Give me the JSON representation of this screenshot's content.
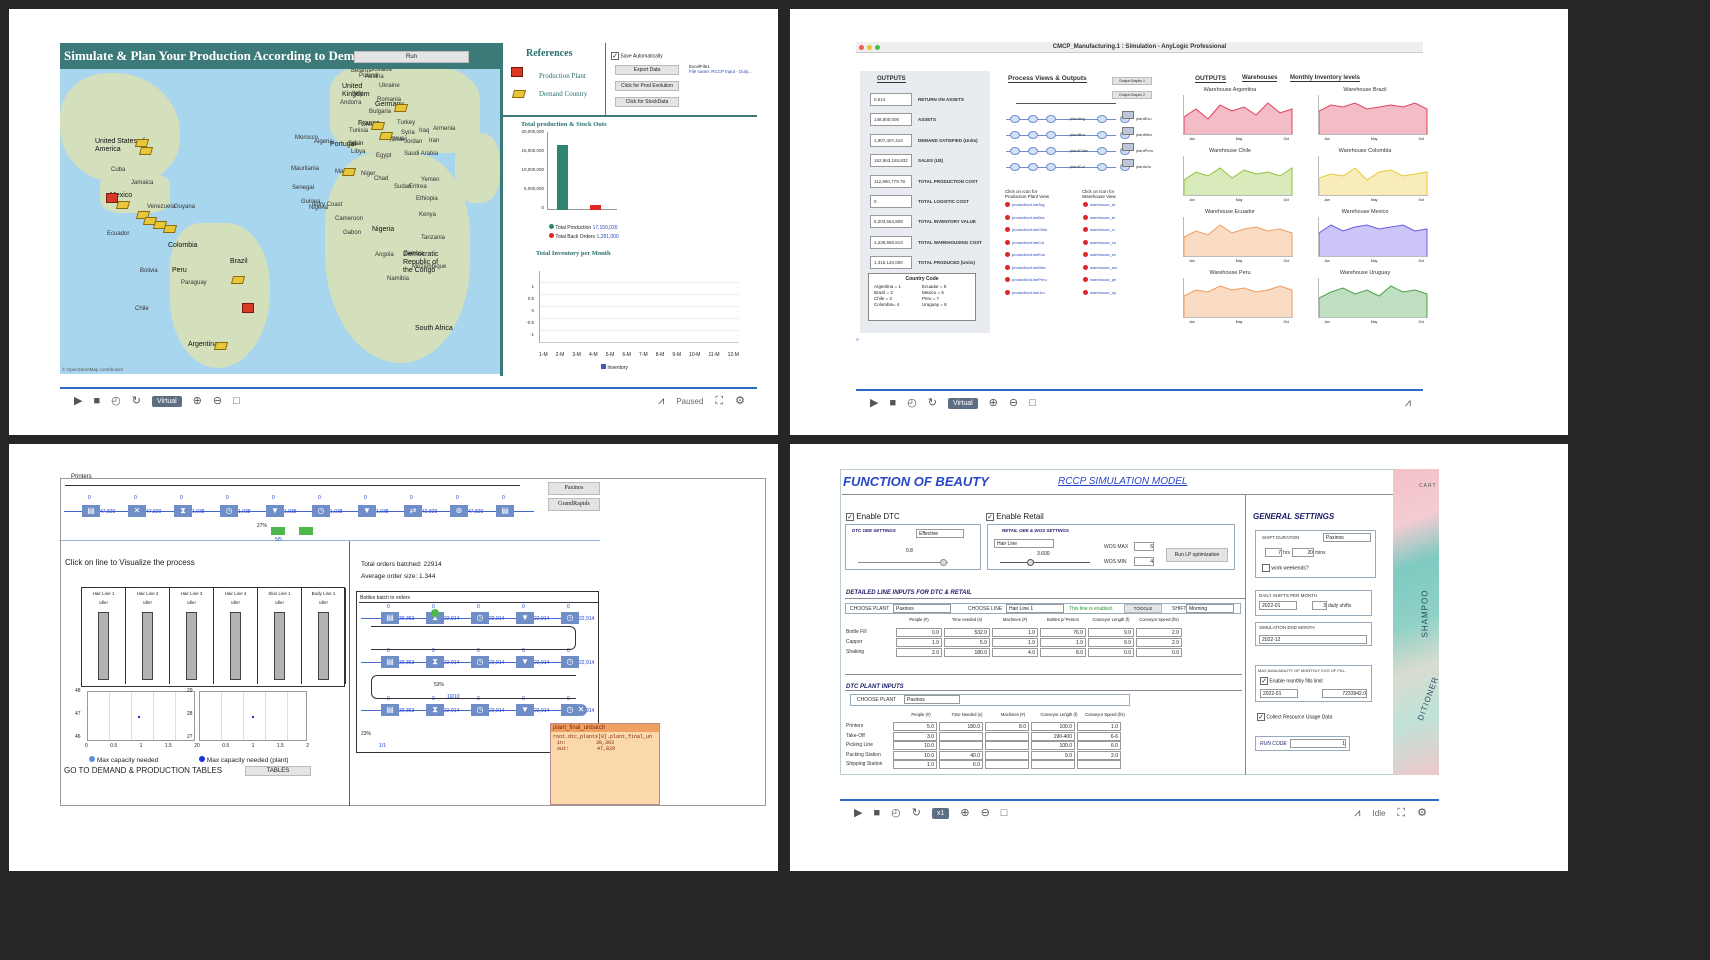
{
  "p1": {
    "title": "Simulate & Plan Your Production According to Demand",
    "run": "Run",
    "references": "References",
    "ref_plant": "Production Plant",
    "ref_country": "Demand Country",
    "save_auto": "Save Automatically",
    "btn_export": "Export Data",
    "btn_prod_evo": "Click for Prod Evolution",
    "btn_stock": "Click for StockData",
    "excel": "ExcelFile1",
    "excel_sub": "File name: RCCP Input - Duly...",
    "chart1_title": "Total production & Stock Outs",
    "chart1_yticks": [
      "20,000,000",
      "15,000,000",
      "10,000,000",
      "5,000,000",
      "0"
    ],
    "legend_prod": "Total Production",
    "legend_prod_val": "17,150,020",
    "legend_back": "Total Back Orders",
    "legend_back_val": "1,281,000",
    "chart2_title": "Total Inventory per Month",
    "chart2_yticks": [
      "1",
      "0.5",
      "0",
      "-0.5",
      "-1"
    ],
    "chart2_xticks": [
      "1-M",
      "2-M",
      "3-M",
      "4-M",
      "5-M",
      "6-M",
      "7-M",
      "8-M",
      "9-M",
      "10-M",
      "11-M",
      "12-M"
    ],
    "legend_inv": "Inventory",
    "osm": "© OpenStreetMap contributors",
    "status": "Paused",
    "virtual": "Virtual",
    "map_labels": [
      "Estonia",
      "Lithuania",
      "Belarus",
      "Poland",
      "Ukraine",
      "Romania",
      "Bulgaria",
      "Greece",
      "Turkey",
      "Cyprus",
      "Syria",
      "Iraq",
      "Iran",
      "Israel",
      "Jordan",
      "Egypt",
      "Saudi Arabia",
      "Libya",
      "Tunisia",
      "Algeria",
      "Morocco",
      "Mauritania",
      "Mali",
      "Niger",
      "Chad",
      "Sudan",
      "Eritrea",
      "Yemen",
      "Ethiopia",
      "Kenya",
      "Tanzania",
      "Angola",
      "Zambia",
      "Namibia",
      "Mozambique",
      "Senegal",
      "Guinea",
      "Ivory Coast",
      "Nigeria",
      "Cameroon",
      "Gabon",
      "Cuba",
      "Jamaica",
      "Venezuela",
      "Guyana",
      "Ecuador",
      "Bolivia",
      "Paraguay",
      "Chile",
      "Czechia",
      "Slovakia",
      "Austria",
      "Italy",
      "Andorra",
      "Armenia"
    ],
    "map_big": {
      "us": "United States of America",
      "uk": "United Kingdom",
      "de": "Germany",
      "fr": "France",
      "pt": "Portugal",
      "pe": "Peru",
      "co": "Colombia",
      "br": "Brazil",
      "ar": "Argentina",
      "mx": "Mexico",
      "ng": "Nigeria",
      "cd": "Democratic Republic of the Congo",
      "za": "South Africa",
      "es": "Spain"
    }
  },
  "p2": {
    "window_title": "CMCP_Manufacturing.1 : Simulation - AnyLogic Professional",
    "outputs": "OUTPUTS",
    "rows": [
      {
        "val": "0.514",
        "label": "RETURN ON ASSETS"
      },
      {
        "val": "148,800,000",
        "label": "ASSETS"
      },
      {
        "val": "1,907,407,414",
        "label": "DEMAND SATISFIED (Units)"
      },
      {
        "val": "162,863,165,832",
        "label": "SALES (U$)"
      },
      {
        "val": "112,960,779.78",
        "label": "TOTAL PRODUCTION COST"
      },
      {
        "val": "0",
        "label": "TOTAL LOGISTIC COST"
      },
      {
        "val": "6,203,564,809",
        "label": "TOTAL INVENTORY VALUE"
      },
      {
        "val": "1,239,560,813",
        "label": "TOTAL WAREHOUSING COST"
      },
      {
        "val": "1,316,140,000",
        "label": "TOTAL PRODUCED (Units)"
      }
    ],
    "country_code": "Country Code",
    "codes": [
      "Argentina = 1",
      "Ecuador = 5",
      "Brazil = 2",
      "Mexico = 6",
      "Chile = 3",
      "Peru = 7",
      "Colombia= 4",
      "Uruguay = 8"
    ],
    "process_title": "Process Views & Outputs",
    "out_graph1": "Output Graphs 1",
    "out_graph2": "Output Graphs 2",
    "plants": [
      "plantArg",
      "plantBra",
      "plantChile",
      "plantCol"
    ],
    "plants_right": [
      "plantEcu",
      "plantMex",
      "plantPeru",
      "plantUru"
    ],
    "click_prod": "Click on Icon for Production Plant View",
    "click_wh": "Click on Icon for Warehouse View",
    "prod_lines": [
      "productionLineArg",
      "productionLineBra",
      "productionLineChile",
      "productionLineCol",
      "productionLineEcu",
      "productionLineMex",
      "productionLinePeru",
      "productionLineUru"
    ],
    "wh_items": [
      "warehouse_ar",
      "warehouse_br",
      "warehouse_cl",
      "warehouse_co",
      "warehouse_ec",
      "warehouse_mx",
      "warehouse_pe",
      "warehouse_uy"
    ],
    "outputs2": "OUTPUTS",
    "tab_wh": "Warehouses",
    "tab_inv": "Monthly Inventory levels",
    "warehouses": [
      {
        "name": "Warehouse Argentina",
        "color": "#e0405f"
      },
      {
        "name": "Warehouse Brazil",
        "color": "#e0405f"
      },
      {
        "name": "Warehouse Chile",
        "color": "#8fc43a"
      },
      {
        "name": "Warehouse Colombia",
        "color": "#e8c93a"
      },
      {
        "name": "Warehouse Ecuador",
        "color": "#f29a5a"
      },
      {
        "name": "Warehouse Mexico",
        "color": "#6a5ce8"
      },
      {
        "name": "Warehouse Peru",
        "color": "#f29a5a"
      },
      {
        "name": "Warehouse Uruguay",
        "color": "#4aa04a"
      }
    ],
    "months": [
      "Jan",
      "May",
      "Oct"
    ],
    "virtual": "Virtual"
  },
  "p3": {
    "title": "Printers",
    "btn1": "Paxinos",
    "btn2": "GrandRapids",
    "flow_vals": [
      "47,829",
      "47,829",
      "1,038",
      "1,038",
      "1,038",
      "1,038",
      "1,038",
      "42,829",
      "47,829"
    ],
    "click_line": "Click on line to Visualize the process",
    "lines": [
      "Hair Line 1",
      "Hair Line 2",
      "Hair Line 3",
      "Hair Line 4",
      "Skin Line 1",
      "Body Line 1"
    ],
    "idle": "Idle!",
    "total_batched": "Total orders batched: 22914",
    "avg_size": "Average order size: 1.344",
    "bottles_title": "Bottles batch to orders",
    "batch_vals": [
      "30,363",
      "22,914",
      "22,914",
      "22,914",
      "22,914"
    ],
    "pct1": "27%",
    "pct2": "53%",
    "pct3": "23%",
    "frac1": "5/5",
    "frac2": "10/10",
    "frac3": "1/1",
    "legend1": "Max capacity needed",
    "legend2": "Max capacity needed (plant)",
    "goto": "GO TO DEMAND & PRODUCTION TABLES",
    "tables": "TABLES",
    "chart_l_y": [
      "48",
      "47",
      "46"
    ],
    "chart_r_y": [
      "29",
      "28",
      "27"
    ],
    "chart_x": [
      "0",
      "0.5",
      "1",
      "1.5",
      "2"
    ],
    "tooltip_title": "plant_final_unbatch",
    "tooltip_l1": "root.dtc_plants[0].plant_final_un",
    "tooltip_in": "in:",
    "tooltip_in_val": "30,363",
    "tooltip_out": "out:",
    "tooltip_out_val": "47,829"
  },
  "p4": {
    "brand": "FUNCTION OF BEAUTY",
    "model": "RCCP SIMULATION MODEL",
    "enable_dtc": "Enable DTC",
    "enable_retail": "Enable Retail",
    "dtc_oee": "DTC OEE SETTINGS",
    "dtc_oee_val": "Effective",
    "dtc_slider_val": "0.8",
    "retail_oee": "RETAIL OEE & WOS SETTINGS",
    "retail_line": "Hair Line",
    "retail_slider_val": "3.600",
    "wos_max": "WOS MAX",
    "wos_max_val": "6",
    "wos_min": "WOS MIN",
    "wos_min_val": "4",
    "run_lp": "Run LP optimization",
    "general": "GENERAL SETTINGS",
    "shift_duration": "SHIFT DURATION",
    "shift_plant": "Paxinos",
    "shift_hrs": "7",
    "hrs": "hrs",
    "shift_mins": "20",
    "mins": "mins",
    "work_weekends": "work weekends?",
    "daily_shifts": "DAILY SHIFTS PER MONTH",
    "daily_month": "2022-01",
    "daily_val": "3",
    "daily_unit": "daily shifts",
    "sim_end": "SIMULATION END MONTH",
    "sim_end_val": "2022-12",
    "max_kgs": "MAX AVAILABILITY OF MONTHLY KGS OF FILL",
    "enable_fills": "Enable monthly fills limit",
    "kgs_month": "2022-01",
    "kgs_val": "7233942.0",
    "collect": "Collect Resource Usage Data",
    "run_code": "RUN CODE",
    "run_code_val": "1",
    "detailed": "DETAILED LINE INPUTS FOR DTC & RETAIL",
    "choose_plant": "CHOOSE PLANT",
    "plant_val": "Paxinos",
    "choose_line": "CHOOSE LINE",
    "line_val": "Hair Line 1",
    "line_enabled": "This line is enabled.",
    "toggle": "TOGGLE",
    "shift": "SHIFT",
    "shift_val": "Morning",
    "cols": [
      "People (#)",
      "Time needed (s)",
      "Machines (#)",
      "Bottles p/ Person",
      "Conveyor Length (f)",
      "Conveyor Speed (f/s)"
    ],
    "line_rows": [
      {
        "name": "Bottle Fill",
        "v": [
          "0.0",
          "532.0",
          "1.0",
          "76.0",
          "9.0",
          "2.0"
        ]
      },
      {
        "name": "Capper",
        "v": [
          "1.0",
          "5.0",
          "1.0",
          "1.0",
          "9.0",
          "2.0"
        ]
      },
      {
        "name": "Shaking",
        "v": [
          "2.0",
          "180.0",
          "4.0",
          "8.0",
          "0.0",
          "0.0"
        ]
      }
    ],
    "dtc_plant": "DTC PLANT INPUTS",
    "dtc_plant_val": "Paxinos",
    "cols2": [
      "People (#)",
      "Time Needed (s)",
      "Machines (#)",
      "Conveyor Length (f)",
      "Conveyor Speed (f/s)"
    ],
    "plant_rows": [
      {
        "name": "Printers",
        "v": [
          "5.0",
          "180.0",
          "8.0",
          "100.0",
          "1.0"
        ]
      },
      {
        "name": "Take-Off",
        "v": [
          "3.0",
          "",
          "",
          "190-400",
          "6-6"
        ]
      },
      {
        "name": "Picking Line",
        "v": [
          "10.0",
          "",
          "",
          "100.0",
          "6.0"
        ]
      },
      {
        "name": "Packing Station",
        "v": [
          "10.0",
          "40.0",
          "",
          "9.0",
          "2.0"
        ]
      },
      {
        "name": "Shipping Station",
        "v": [
          "1.0",
          "6.0",
          "",
          "",
          ""
        ]
      }
    ],
    "status": "Idle",
    "speed": "x1",
    "cart": "CART",
    "bottle_txt1": "SHAMPOO",
    "bottle_txt2": "DITIONER"
  }
}
